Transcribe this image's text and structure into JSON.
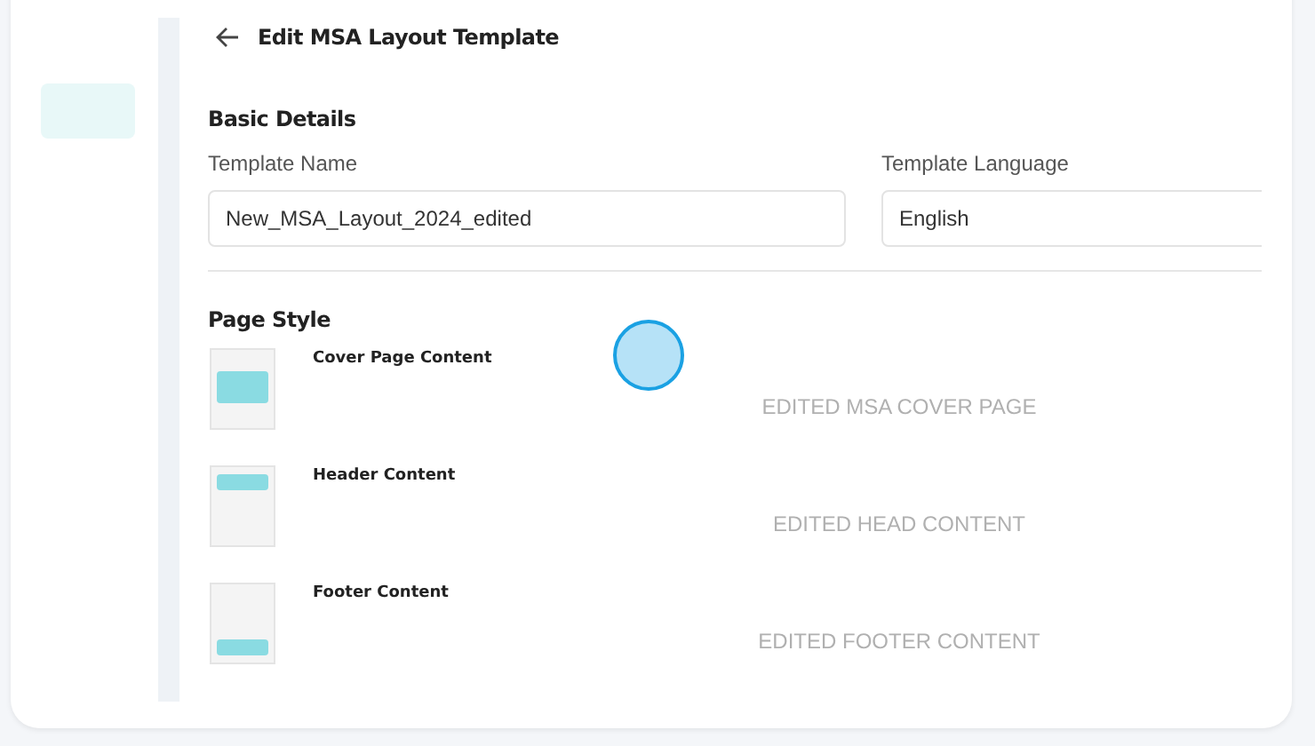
{
  "header": {
    "title": "Edit MSA Layout Template"
  },
  "basic_details": {
    "heading": "Basic Details",
    "template_name": {
      "label": "Template Name",
      "value": "New_MSA_Layout_2024_edited"
    },
    "template_language": {
      "label": "Template Language",
      "value": "English"
    }
  },
  "page_style": {
    "heading": "Page Style",
    "items": [
      {
        "kind": "cover",
        "title": "Cover Page Content",
        "value": "EDITED MSA COVER PAGE"
      },
      {
        "kind": "header",
        "title": "Header Content",
        "value": "EDITED HEAD CONTENT"
      },
      {
        "kind": "footer",
        "title": "Footer Content",
        "value": "EDITED FOOTER CONTENT"
      }
    ]
  }
}
